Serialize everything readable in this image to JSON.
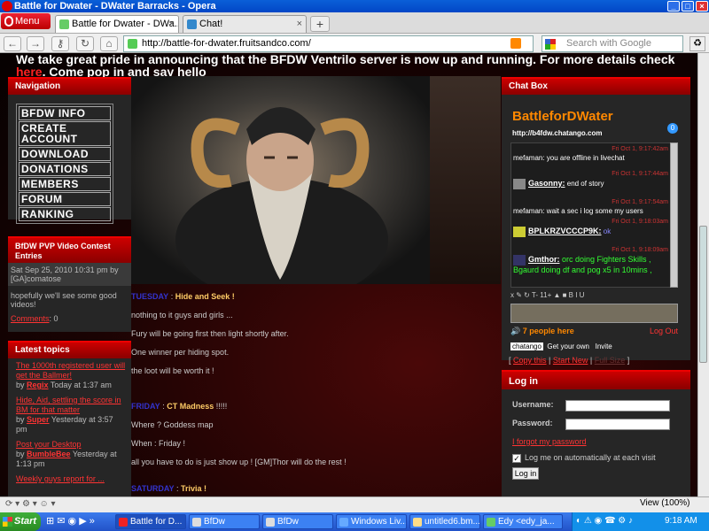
{
  "window": {
    "title": "Battle for Dwater - DWater Barracks - Opera"
  },
  "browser": {
    "menu_label": "Menu",
    "tabs": [
      {
        "label": "Battle for Dwater - DWa..."
      },
      {
        "label": "Chat!"
      }
    ],
    "url": "http://battle-for-dwater.fruitsandco.com/",
    "search_placeholder": "Search with Google",
    "status_zoom": "View (100%)"
  },
  "announcement": {
    "text_before": "We take great pride in announcing that the BFDW Ventrilo server is now up and running. For more details check ",
    "link": "here",
    "text_after": ". Come pop in and say hello"
  },
  "navigation": {
    "title": "Navigation",
    "items": [
      "BFDW INFO",
      "CREATE ACCOUNT",
      "DOWNLOAD",
      "DONATIONS",
      "MEMBERS",
      "FORUM",
      "RANKING"
    ]
  },
  "contest": {
    "title": "BfDW PVP Video Contest Entries",
    "meta": "Sat Sep 25, 2010 10:31 pm by [GA]comatose",
    "body": "hopefully we'll see some good videos!",
    "comments_label": "Comments",
    "comments_count": ": 0"
  },
  "topics": {
    "title": "Latest topics",
    "items": [
      {
        "title": "The 1000th registered user will get the Ballmer!",
        "by": "by",
        "user": "Regix",
        "time": "Today at 1:37 am"
      },
      {
        "title": "Hide, Aid, settling the score in BM for that matter",
        "by": "by",
        "user": "Super",
        "time": "Yesterday at 3:57 pm"
      },
      {
        "title": "Post your Desktop",
        "by": "by",
        "user": "BumbleBee",
        "time": "Yesterday at 1:13 pm"
      },
      {
        "title": "Weekly guys report for ...",
        "by": "",
        "user": "",
        "time": ""
      }
    ]
  },
  "posts": {
    "lines": [
      {
        "day": "TUESDAY",
        "sep": " : ",
        "event": "Hide and Seek !"
      },
      {
        "text": "nothing to it guys and girls ..."
      },
      {
        "text": "Fury will be going first then light shortly after."
      },
      {
        "text": "One winner per hiding spot."
      },
      {
        "text": "the loot will be worth it !"
      },
      {
        "day": "FRIDAY",
        "sep": " : ",
        "event": "CT Madness",
        "tail": " !!!!!"
      },
      {
        "text": "Where ? Goddess map"
      },
      {
        "text": "When : Friday !"
      },
      {
        "text": "all you have to do is just show up ! [GM]Thor will do the rest !"
      },
      {
        "day": "SATURDAY",
        "sep": " : ",
        "event": "Trivia !"
      }
    ]
  },
  "chat": {
    "panel_title": "Chat Box",
    "name": "BattleforDWater",
    "url": "http://b4fdw.chatango.com",
    "badge": "0",
    "messages": [
      {
        "ts": "Fri Oct 1, 9:17:42am",
        "text": "mefaman: you are offline in livechat"
      },
      {
        "ts": "Fri Oct 1, 9:17:44am",
        "user": "Gasonny:",
        "text": " end of story"
      },
      {
        "ts": "Fri Oct 1, 9:17:54am",
        "text": "mefaman: wait a sec i log some my users"
      },
      {
        "ts": "Fri Oct 1, 9:18:03am",
        "user": "BPLKRZVCCCP9K:",
        "text": " ok"
      },
      {
        "ts": "Fri Oct 1, 9:18:09am",
        "user": "Gmthor:",
        "text": " orc doing Fighters Skills , Bgaurd doing df and pog x5 in 10mins ,"
      }
    ],
    "toolbar": "x ✎ ↻ T- 11+ ▲ ■ B I U",
    "people_here": "7 people here",
    "logout": "Log Out",
    "chatango": "chatango",
    "get_your_own": "Get your own",
    "invite": "Invite",
    "copy_this": "Copy this",
    "start_new": "Start New",
    "full_size": "Full Size"
  },
  "login": {
    "title": "Log in",
    "username_label": "Username:",
    "password_label": "Password:",
    "forgot": "I forgot my password",
    "remember": "Log me on automatically at each visit",
    "button": "Log in"
  },
  "taskbar": {
    "start": "Start",
    "items": [
      "Battle for D...",
      "BfDw",
      "BfDw",
      "Windows Liv...",
      "untitled6.bm...",
      "Edy <edy_ja..."
    ],
    "clock": "9:18 AM"
  }
}
